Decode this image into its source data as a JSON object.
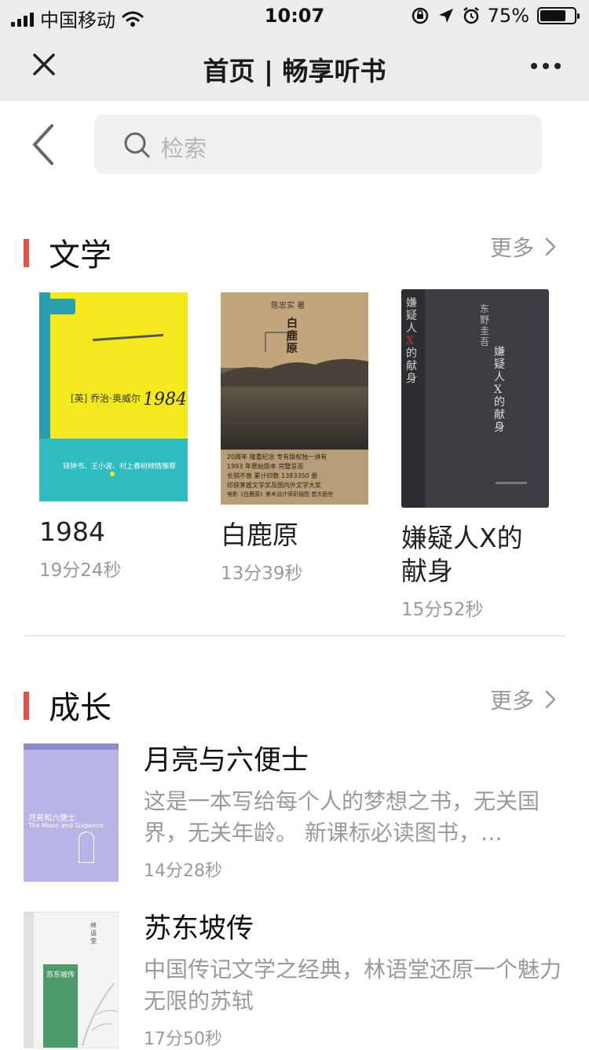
{
  "status": {
    "carrier": "中国移动",
    "time": "10:07",
    "battery_text": "75%",
    "battery_level": 0.75
  },
  "nav": {
    "title": "首页 | 畅享听书"
  },
  "search": {
    "placeholder": "检索"
  },
  "sections": [
    {
      "title": "文学",
      "more_label": "更多",
      "books": [
        {
          "title": "1984",
          "duration": "19分24秒",
          "cover": {
            "author": "[英] 乔治·奥威尔",
            "title": "1984",
            "blurb": "钱钟书、王小波、村上春树倾情推荐",
            "colors": [
              "#f3e91c",
              "#2fbcc0"
            ]
          }
        },
        {
          "title": "白鹿原",
          "duration": "13分39秒",
          "cover": {
            "author": "陈忠实 著",
            "title": "白鹿原",
            "lines": [
              "20周年 隆重纪念 专有版权独一讲有",
              "1993 年原始版本 完整呈现",
              "长销不衰 累计印数 1383350 册",
              "印获茅盾文学奖及国内外文学大奖",
              "电影《白鹿原》美术设计师彩插图 首次面世"
            ],
            "colors": [
              "#c2a57c",
              "#3b352f"
            ]
          }
        },
        {
          "title": "嫌疑人X的献身",
          "duration": "15分52秒",
          "cover": {
            "author": "东野圭吾",
            "title": "嫌疑人X的献身",
            "colors": [
              "#3b3d42",
              "#c0392b"
            ]
          }
        }
      ]
    },
    {
      "title": "成长",
      "more_label": "更多",
      "items": [
        {
          "title": "月亮与六便士",
          "description": "这是一本写给每个人的梦想之书，无关国界，无关年龄。 新课标必读图书，…",
          "duration": "14分28秒",
          "cover": {
            "title": "月亮和六便士",
            "subtitle": "The Moon and Sixpence",
            "colors": [
              "#b8b4e6",
              "#ffffff"
            ]
          }
        },
        {
          "title": "苏东坡传",
          "description": "中国传记文学之经典，林语堂还原一个魅力无限的苏轼",
          "duration": "17分50秒",
          "cover": {
            "title": "苏东坡传",
            "author": "林语堂",
            "colors": [
              "#f4f4f2",
              "#4e9a6a"
            ]
          }
        }
      ]
    }
  ]
}
